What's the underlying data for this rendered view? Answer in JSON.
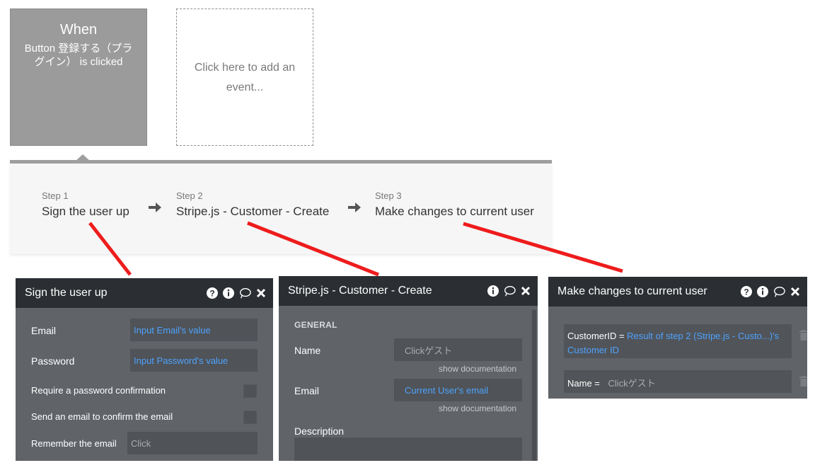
{
  "event": {
    "title": "When",
    "text": "Button 登録する（プラグイン） is clicked",
    "add_event": "Click here to add an event..."
  },
  "steps": [
    {
      "num": "Step 1",
      "name": "Sign the user up"
    },
    {
      "num": "Step 2",
      "name": "Stripe.js - Customer - Create"
    },
    {
      "num": "Step 3",
      "name": "Make changes to current user"
    }
  ],
  "panel_signup": {
    "title": "Sign the user up",
    "email_label": "Email",
    "email_value": "Input Email's value",
    "password_label": "Password",
    "password_value": "Input Password's value",
    "require_confirm_label": "Require a password confirmation",
    "send_email_label": "Send an email to confirm the email",
    "remember_label": "Remember the email",
    "remember_placeholder": "Click"
  },
  "panel_stripe": {
    "title": "Stripe.js - Customer - Create",
    "section": "GENERAL",
    "name_label": "Name",
    "name_value": "Clickゲスト",
    "show_doc_1": "show documentation",
    "email_label": "Email",
    "email_value": "Current User's email",
    "show_doc_2": "show documentation",
    "description_label": "Description"
  },
  "panel_changes": {
    "title": "Make changes to current user",
    "row1_key": "CustomerID = ",
    "row1_value": "Result of step 2 (Stripe.js - Custo...)'s Customer ID",
    "row2_key": "Name = ",
    "row2_value": "Clickゲスト"
  },
  "colors": {
    "event_box": "#9b9b9b",
    "panel_head": "#2b2f33",
    "panel_body": "#606469",
    "link_blue": "#4da3ff",
    "annotation_red": "#ee1c1c"
  }
}
